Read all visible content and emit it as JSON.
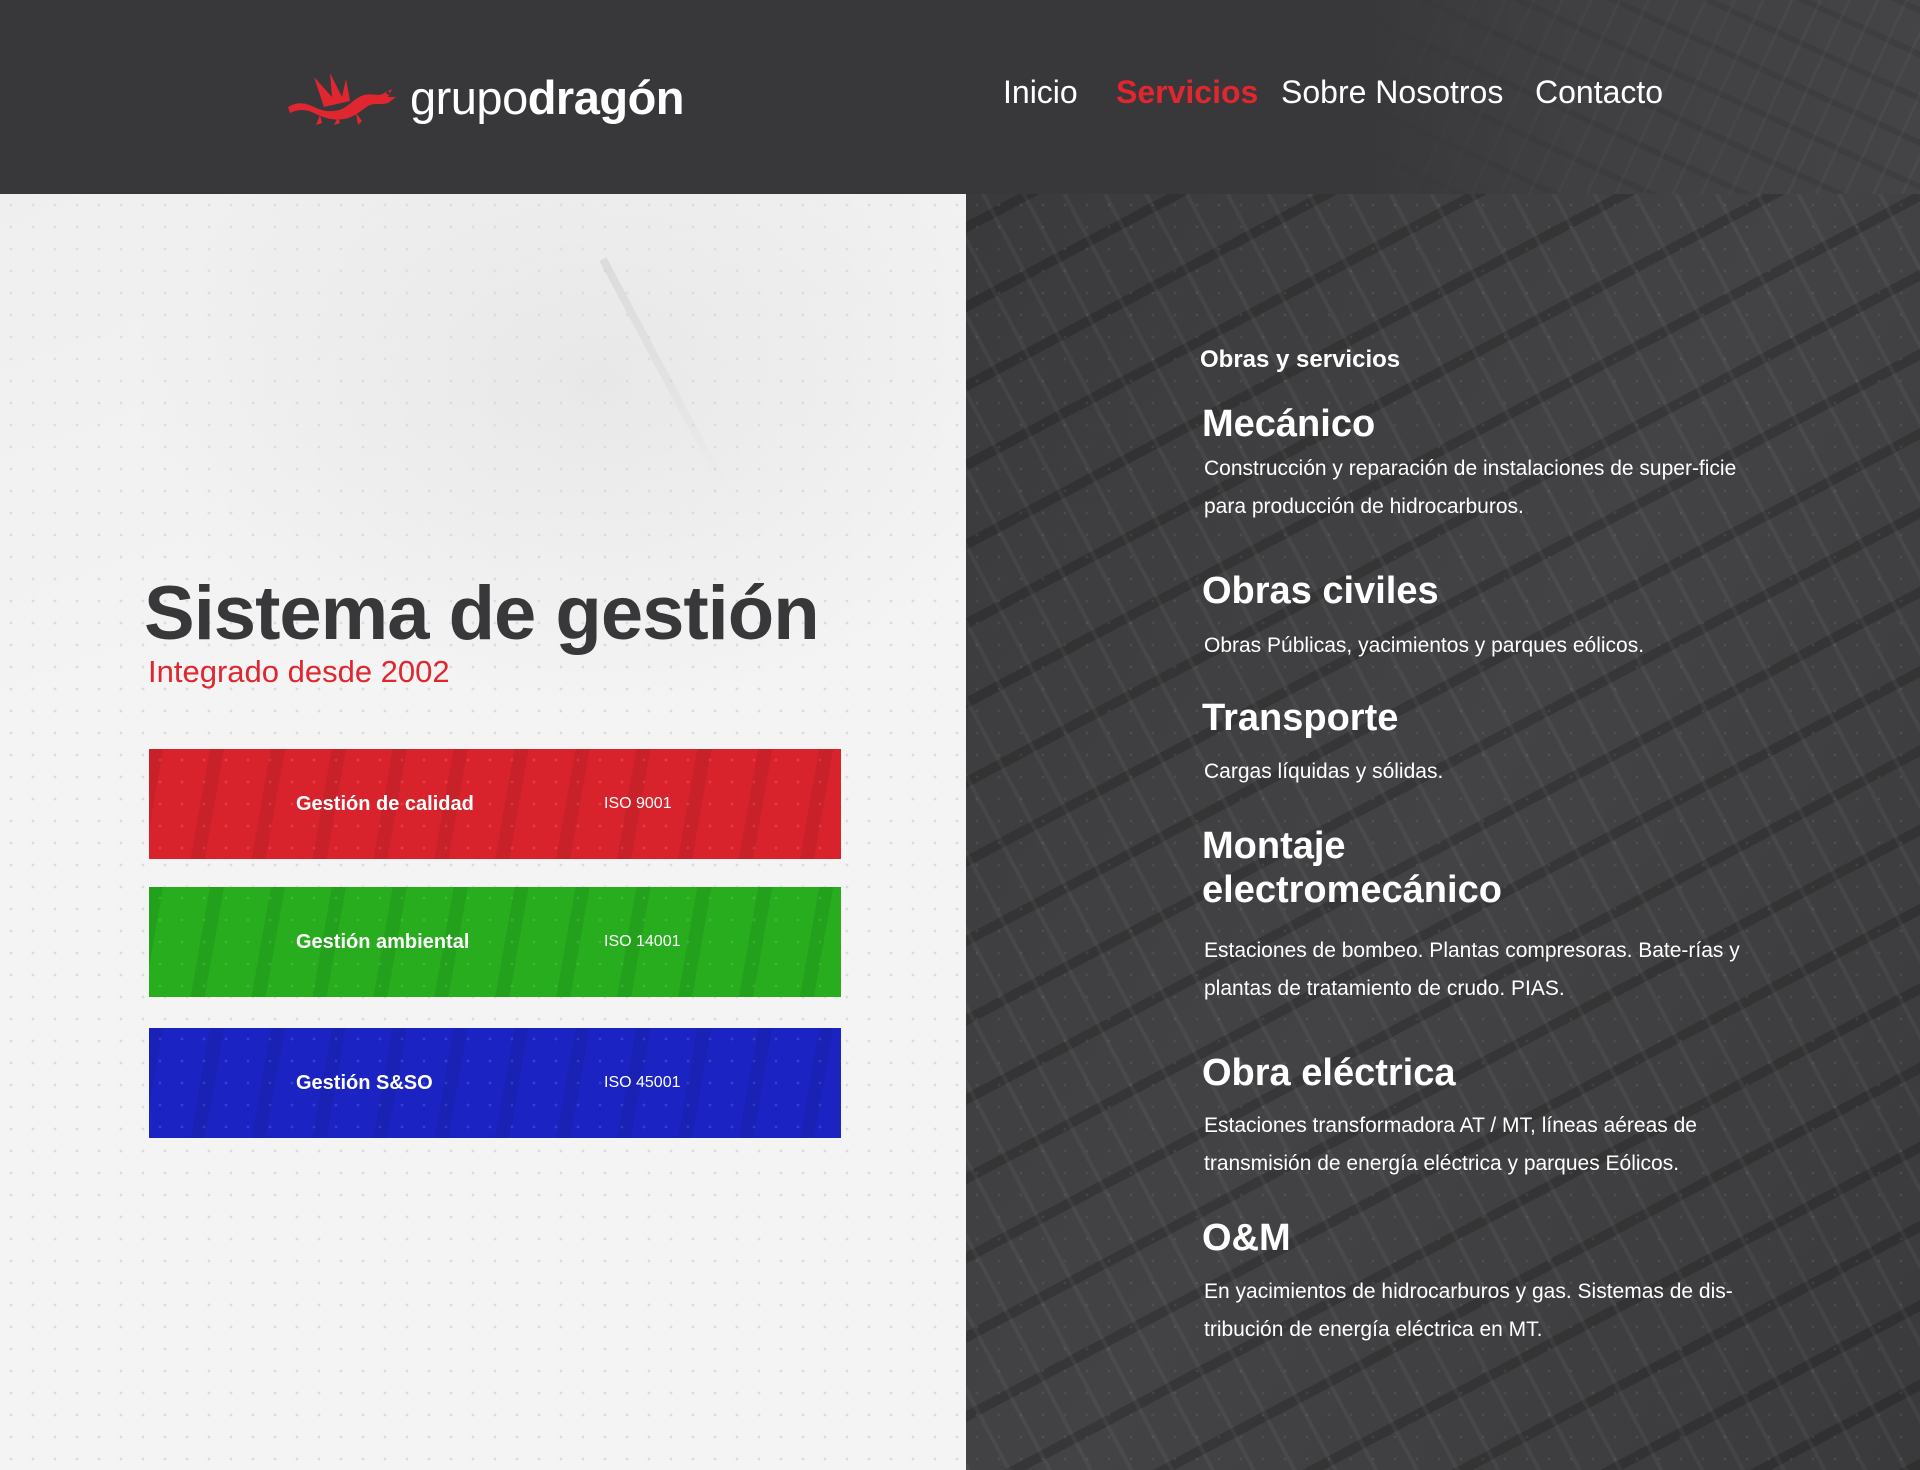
{
  "header": {
    "logo": {
      "icon": "dragon-icon",
      "text_light": "grupo",
      "text_bold": "dragón"
    },
    "nav": [
      {
        "label": "Inicio",
        "active": false
      },
      {
        "label": "Servicios",
        "active": true
      },
      {
        "label": "Sobre Nosotros",
        "active": false
      },
      {
        "label": "Contacto",
        "active": false
      }
    ]
  },
  "management": {
    "title": "Sistema de gestión",
    "subtitle": "Integrado desde 2002",
    "cards": [
      {
        "name": "Gestión de calidad",
        "code": "ISO 9001",
        "color": "#d8232d"
      },
      {
        "name": "Gestión ambiental",
        "code": "ISO 14001",
        "color": "#27ad1e"
      },
      {
        "name": "Gestión S&SO",
        "code": "ISO 45001",
        "color": "#1b24c2"
      }
    ]
  },
  "services": {
    "eyebrow": "Obras y servicios",
    "items": [
      {
        "title": "Mecánico",
        "description": "Construcción y reparación de instalaciones de super-ficie para producción de hidrocarburos."
      },
      {
        "title": "Obras civiles",
        "description": "Obras Públicas, yacimientos y parques eólicos."
      },
      {
        "title": "Transporte",
        "description": "Cargas líquidas y sólidas."
      },
      {
        "title": "Montaje electromecánico",
        "description": "Estaciones de bombeo. Plantas compresoras. Bate-rías y plantas de tratamiento de crudo. PIAS."
      },
      {
        "title": "Obra eléctrica",
        "description": "Estaciones transformadora AT / MT, líneas aéreas de transmisión de energía eléctrica y parques Eólicos."
      },
      {
        "title": "O&M",
        "description": "En yacimientos de hidrocarburos y gas. Sistemas de dis-tribución de energía eléctrica en MT."
      }
    ]
  },
  "colors": {
    "accent": "#e0262e",
    "header_bg": "#38383a",
    "panel_dark": "#3a3a3c",
    "panel_light": "#f4f4f4"
  }
}
